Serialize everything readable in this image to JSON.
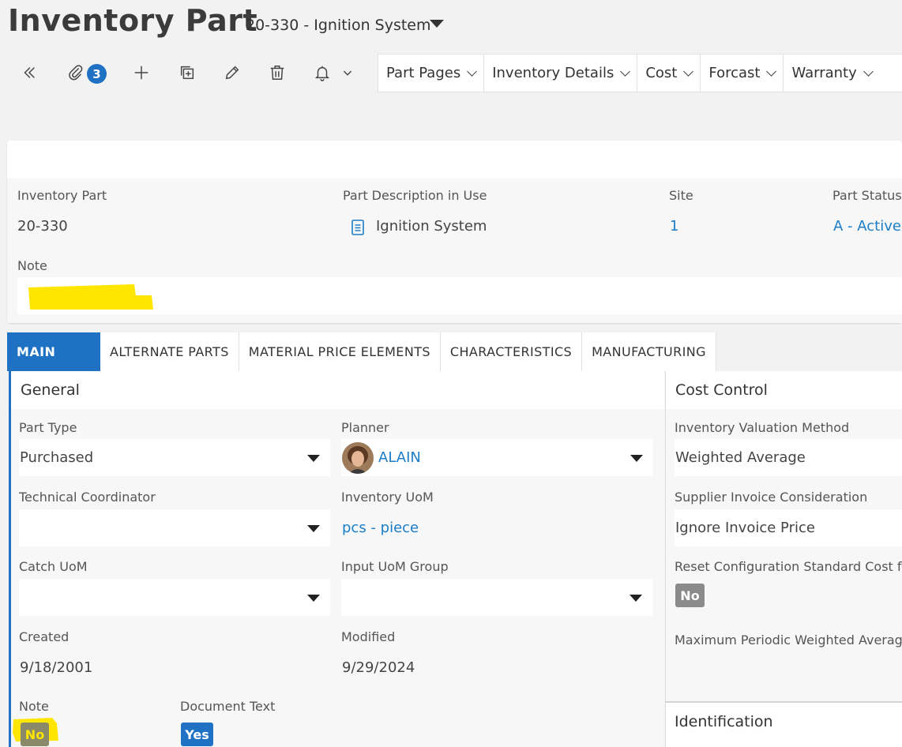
{
  "header": {
    "title": "Inventory Part",
    "context": "20-330 - Ignition System"
  },
  "toolbar": {
    "attachments_count": "3",
    "icons": [
      "back-double-chevron-icon",
      "paperclip-icon",
      "plus-icon",
      "duplicate-icon",
      "pencil-icon",
      "trash-icon",
      "bell-icon",
      "chevron-down-icon"
    ],
    "menus": [
      {
        "label": "Part Pages"
      },
      {
        "label": "Inventory Details"
      },
      {
        "label": "Cost"
      },
      {
        "label": "Forcast"
      },
      {
        "label": "Warranty"
      }
    ]
  },
  "summary": {
    "inventory_part_label": "Inventory Part",
    "inventory_part_value": "20-330",
    "description_label": "Part Description in Use",
    "description_value": "Ignition System",
    "site_label": "Site",
    "site_value": "1",
    "status_label": "Part Status",
    "status_value": "A - Active",
    "note_label": "Note",
    "highlight_color": "#ffe600"
  },
  "tabs": [
    {
      "label": "MAIN",
      "active": true
    },
    {
      "label": "ALTERNATE PARTS"
    },
    {
      "label": "MATERIAL PRICE ELEMENTS"
    },
    {
      "label": "CHARACTERISTICS"
    },
    {
      "label": "MANUFACTURING"
    }
  ],
  "general": {
    "title": "General",
    "part_type_label": "Part Type",
    "part_type_value": "Purchased",
    "planner_label": "Planner",
    "planner_value": "ALAIN",
    "tech_coord_label": "Technical Coordinator",
    "inv_uom_label": "Inventory UoM",
    "inv_uom_value": "pcs - piece",
    "catch_uom_label": "Catch UoM",
    "input_uom_label": "Input UoM Group",
    "created_label": "Created",
    "created_value": "9/18/2001",
    "modified_label": "Modified",
    "modified_value": "9/29/2024",
    "note_label": "Note",
    "note_value": "No",
    "doc_text_label": "Document Text",
    "doc_text_value": "Yes"
  },
  "cost_control": {
    "title": "Cost Control",
    "valuation_label": "Inventory Valuation Method",
    "valuation_value": "Weighted Average",
    "supplier_label": "Supplier Invoice Consideration",
    "supplier_value": "Ignore Invoice Price",
    "reset_label": "Reset Configuration Standard Cost fro",
    "reset_value": "No",
    "max_label": "Maximum Periodic Weighted Average"
  },
  "identification": {
    "title": "Identification"
  },
  "colors": {
    "accent": "#1f72c3",
    "link": "#1b7dc7",
    "highlight": "#ffe600"
  }
}
